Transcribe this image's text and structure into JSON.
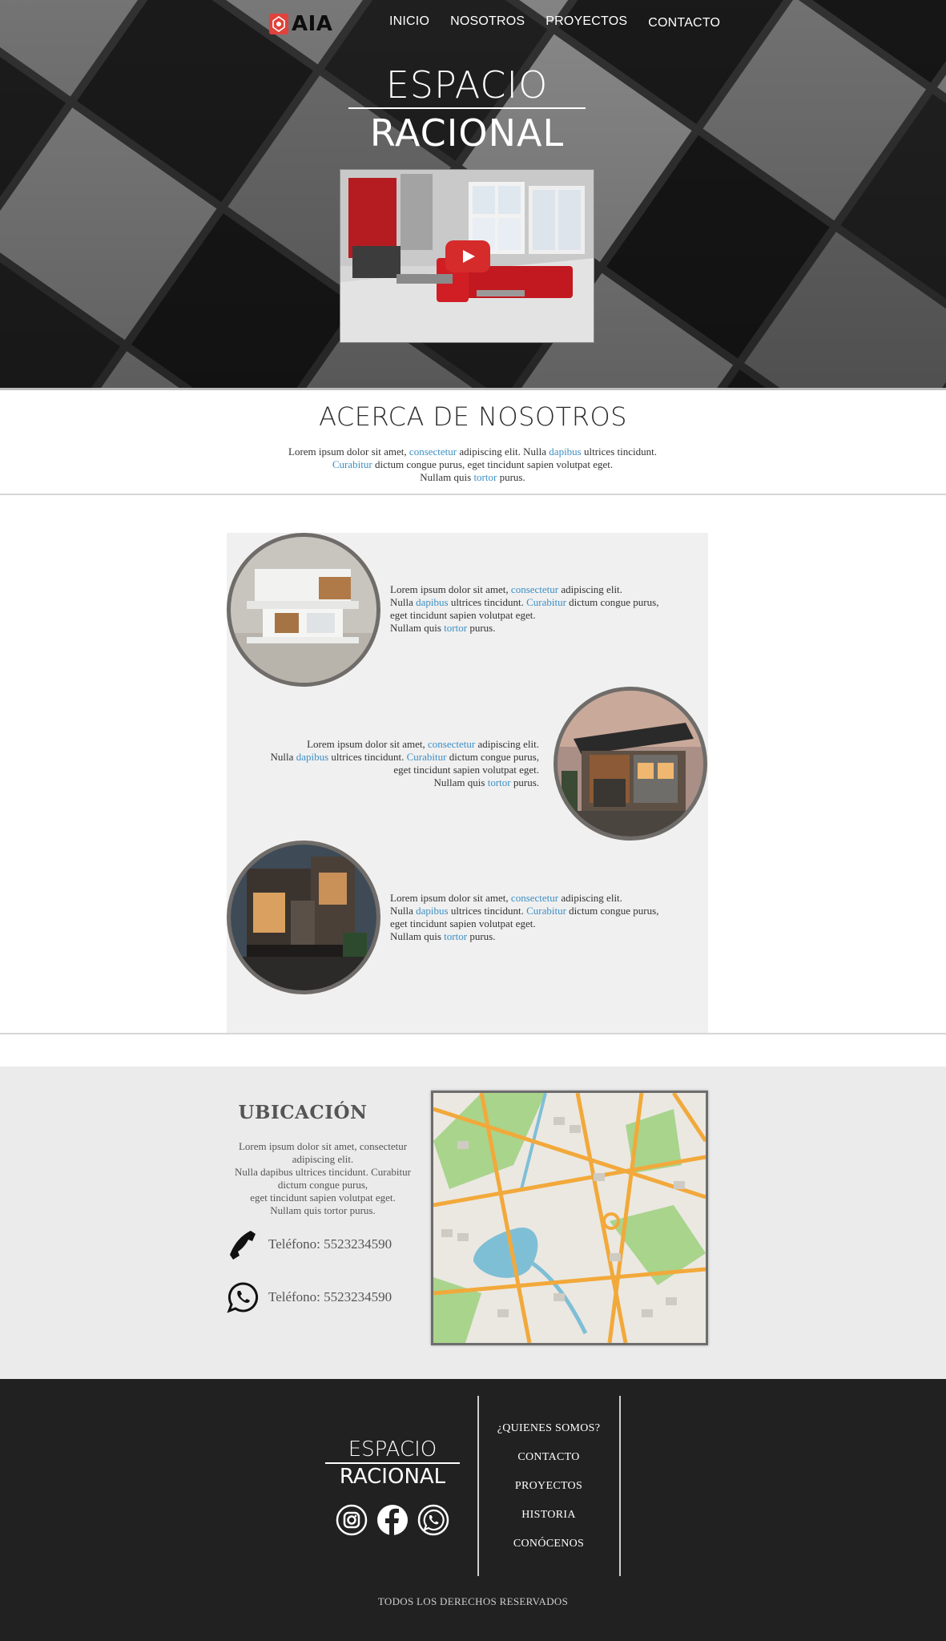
{
  "header": {
    "logo_text": "AIA",
    "nav": [
      "INICIO",
      "NOSOTROS",
      "PROYECTOS",
      "CONTACTO"
    ]
  },
  "hero": {
    "brand_line1": "ESPACIO",
    "brand_line2": "RACIONAL",
    "video": {
      "play_icon": "youtube-play-icon"
    }
  },
  "about": {
    "title": "ACERCA DE NOSOTROS",
    "text": {
      "s1": "Lorem ipsum dolor sit amet, ",
      "k1": "consectetur",
      "s2": " adipiscing elit. Nulla ",
      "k2": "dapibus",
      "s3": " ultrices tincidunt.",
      "k3": "Curabitur",
      "s4": " dictum congue purus, eget tincidunt sapien volutpat eget.",
      "s5": "Nullam quis ",
      "k4": "tortor",
      "s6": " purus."
    }
  },
  "features": [
    {
      "a": "Lorem ipsum dolor sit amet, ",
      "k1": "consectetur",
      "b": " adipiscing elit.",
      "c": "Nulla ",
      "k2": "dapibus",
      "d": " ultrices tincidunt. ",
      "k3": "Curabitur",
      "e": " dictum congue purus,",
      "f": "eget tincidunt sapien volutpat eget.",
      "g": "Nullam quis ",
      "k4": "tortor",
      "h": " purus."
    },
    {
      "a": "Lorem ipsum dolor sit amet, ",
      "k1": "consectetur",
      "b": " adipiscing elit.",
      "c": "Nulla ",
      "k2": "dapibus",
      "d": " ultrices tincidunt. ",
      "k3": "Curabitur",
      "e": " dictum congue purus,",
      "f": "eget tincidunt sapien volutpat eget.",
      "g": "Nullam quis ",
      "k4": "tortor",
      "h": " purus."
    },
    {
      "a": "Lorem ipsum dolor sit amet, ",
      "k1": "consectetur",
      "b": " adipiscing elit.",
      "c": "Nulla ",
      "k2": "dapibus",
      "d": " ultrices tincidunt. ",
      "k3": "Curabitur",
      "e": " dictum congue purus,",
      "f": "eget tincidunt sapien volutpat eget.",
      "g": "Nullam quis ",
      "k4": "tortor",
      "h": " purus."
    }
  ],
  "location": {
    "title": "UBICACIÓN",
    "lines": [
      "Lorem ipsum dolor sit amet, consectetur",
      "adipiscing elit.",
      "Nulla dapibus ultrices tincidunt. Curabitur",
      "dictum congue purus,",
      "eget tincidunt sapien volutpat eget.",
      "Nullam quis tortor purus."
    ],
    "phone1": "Teléfono: 5523234590",
    "phone2": "Teléfono: 5523234590",
    "phone_icon": "phone-icon",
    "whatsapp_icon": "whatsapp-icon"
  },
  "footer": {
    "brand_line1": "ESPACIO",
    "brand_line2": "RACIONAL",
    "social": [
      "instagram-icon",
      "facebook-icon",
      "whatsapp-icon"
    ],
    "links": [
      "¿QUIENES SOMOS?",
      "CONTACTO",
      "PROYECTOS",
      "HISTORIA",
      "CONÓCENOS"
    ],
    "rights": "TODOS LOS DERECHOS RESERVADOS"
  },
  "colors": {
    "link": "#3d8fc4",
    "logo_red": "#e0423c",
    "play_red": "#d62b2b",
    "footer_bg": "#212121",
    "location_bg": "#ebebeb",
    "features_bg": "#f0f0f0"
  }
}
